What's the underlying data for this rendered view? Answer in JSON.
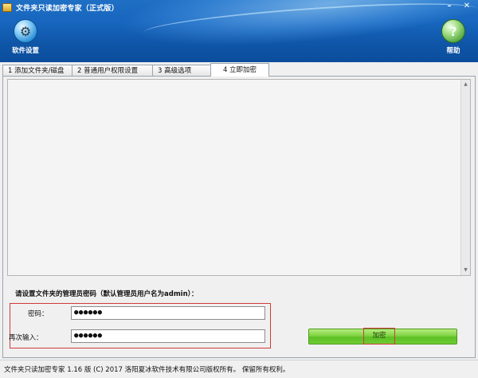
{
  "window": {
    "title": "文件夹只读加密专家（正式版）",
    "minimize_glyph": "–",
    "close_glyph": "✕"
  },
  "toolbar": {
    "settings": {
      "label": "软件设置",
      "icon": "gear-icon"
    },
    "help": {
      "label": "帮助",
      "icon": "question-icon"
    }
  },
  "tabs": [
    {
      "label": "1 添加文件夹/磁盘",
      "active": false
    },
    {
      "label": "2 普通用户权限设置",
      "active": false
    },
    {
      "label": "3 高级选项",
      "active": false
    },
    {
      "label": "4 立即加密",
      "active": true
    }
  ],
  "encrypt_panel": {
    "instruction": "请设置文件夹的管理员密码（默认管理员用户名为admin）：",
    "password_label": "密码：",
    "password_value": "●●●●●●",
    "confirm_label": "再次输入：",
    "confirm_value": "●●●●●●",
    "encrypt_button": "加密"
  },
  "status_bar": {
    "text": "文件夹只读加密专家 1.16 版 (C) 2017 洛阳夏冰软件技术有限公司版权所有。 保留所有权利。"
  },
  "colors": {
    "header_blue": "#1766bf",
    "button_green": "#6fcd33",
    "highlight_red": "#d23a3a"
  }
}
